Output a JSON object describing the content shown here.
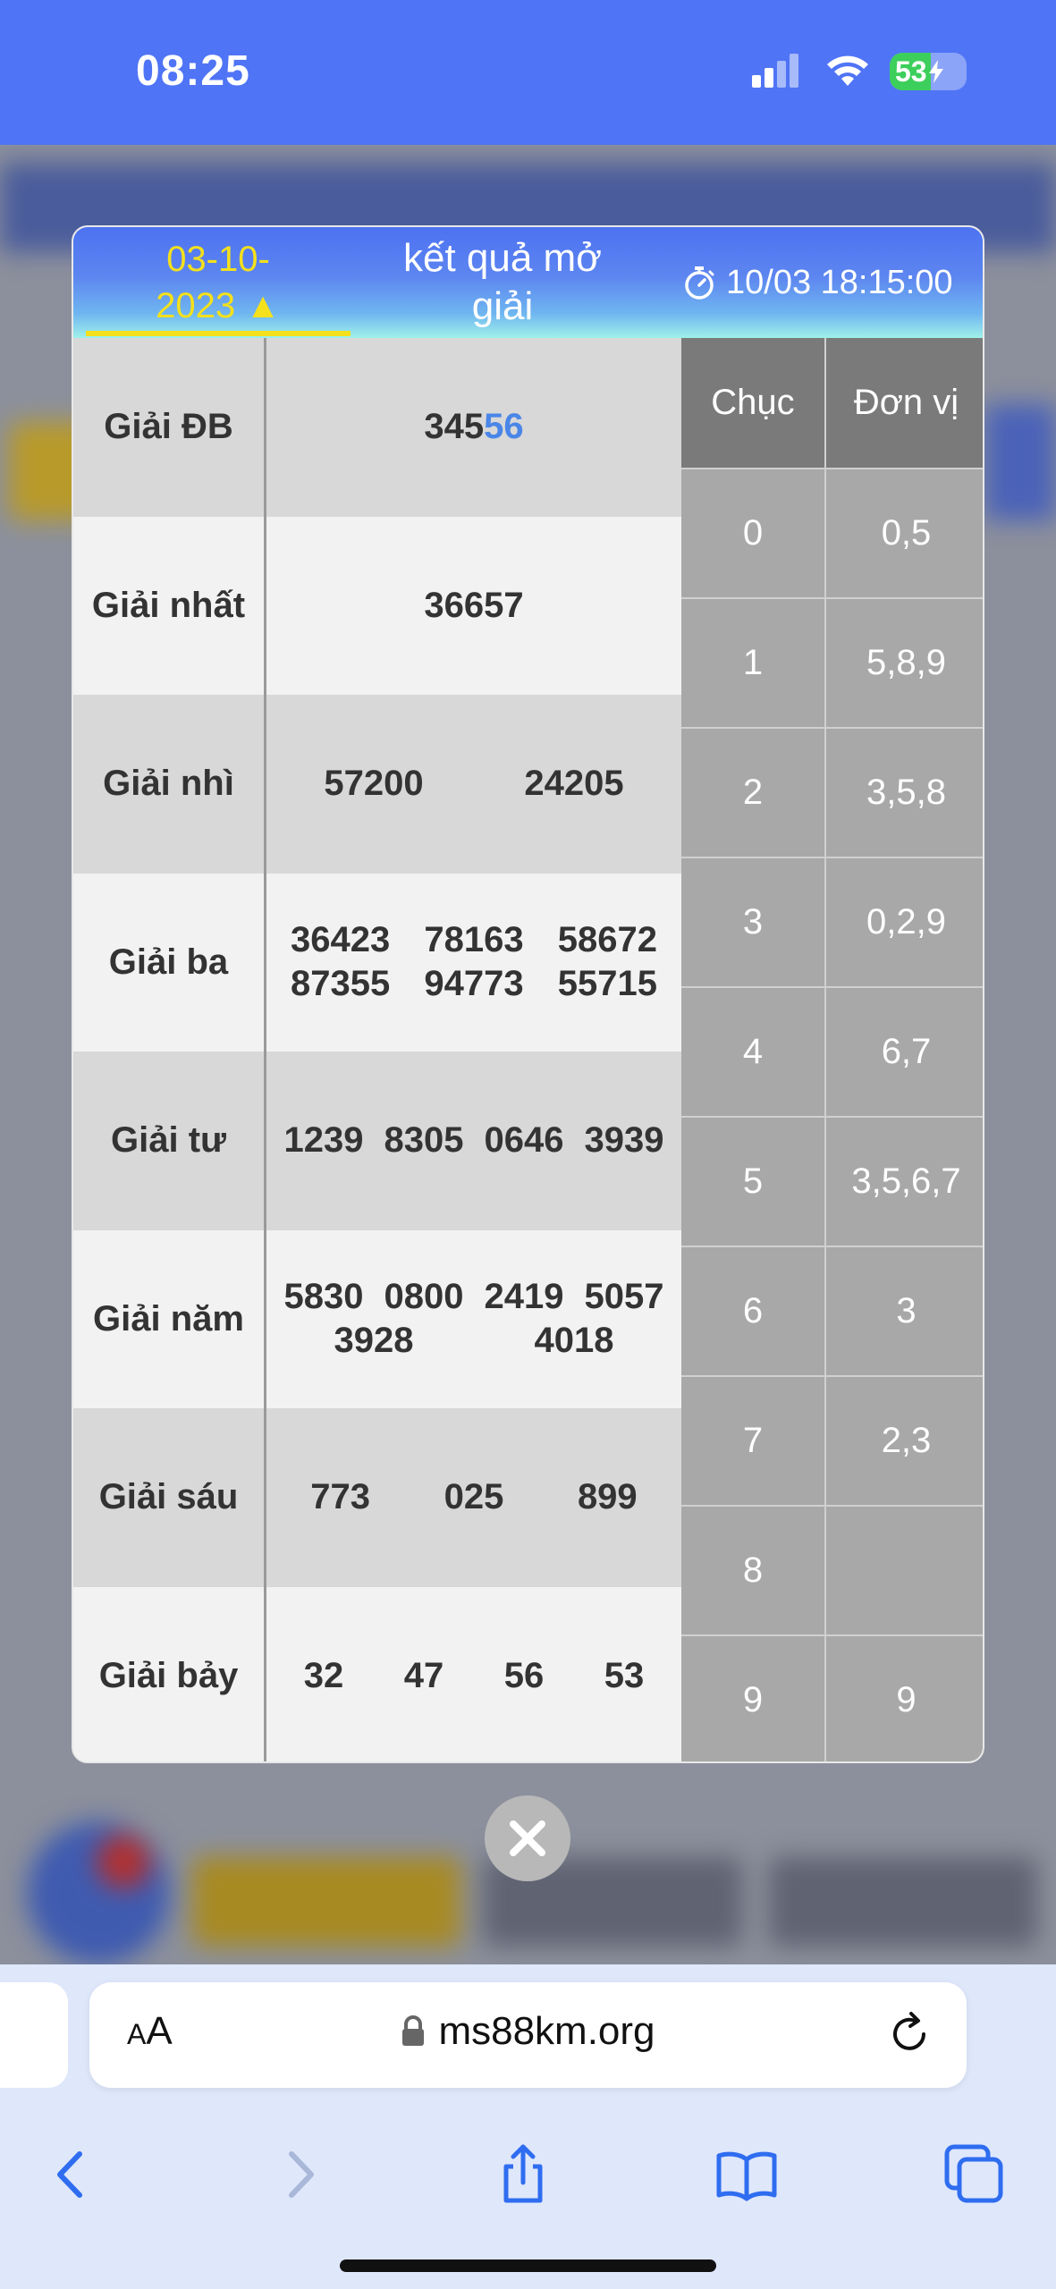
{
  "status_bar": {
    "time": "08:25",
    "battery": "53",
    "battery_level": 0.53
  },
  "modal": {
    "date_line1": "03-10-",
    "date_line2": "2023 ▲",
    "title_line1": "kết quả mở",
    "title_line2": "giải",
    "countdown": "10/03 18:15:00",
    "prizes": [
      {
        "name": "Giải ĐB",
        "numbers": [
          "345",
          "56"
        ]
      },
      {
        "name": "Giải nhất",
        "numbers": [
          "36657"
        ]
      },
      {
        "name": "Giải nhì",
        "numbers": [
          "57200",
          "24205"
        ]
      },
      {
        "name": "Giải ba",
        "numbers": [
          "36423",
          "78163",
          "58672",
          "87355",
          "94773",
          "55715"
        ]
      },
      {
        "name": "Giải tư",
        "numbers": [
          "1239",
          "8305",
          "0646",
          "3939"
        ]
      },
      {
        "name": "Giải năm",
        "numbers": [
          "5830",
          "0800",
          "2419",
          "5057",
          "3928",
          "4018"
        ]
      },
      {
        "name": "Giải sáu",
        "numbers": [
          "773",
          "025",
          "899"
        ]
      },
      {
        "name": "Giải bảy",
        "numbers": [
          "32",
          "47",
          "56",
          "53"
        ]
      }
    ],
    "dan_table": {
      "header_chuc": "Chục",
      "header_donvi": "Đơn vị",
      "rows": [
        {
          "chuc": "0",
          "donvi": "0,5"
        },
        {
          "chuc": "1",
          "donvi": "5,8,9"
        },
        {
          "chuc": "2",
          "donvi": "3,5,8"
        },
        {
          "chuc": "3",
          "donvi": "0,2,9"
        },
        {
          "chuc": "4",
          "donvi": "6,7"
        },
        {
          "chuc": "5",
          "donvi": "3,5,6,7"
        },
        {
          "chuc": "6",
          "donvi": "3"
        },
        {
          "chuc": "7",
          "donvi": "2,3"
        },
        {
          "chuc": "8",
          "donvi": ""
        },
        {
          "chuc": "9",
          "donvi": "9"
        }
      ]
    }
  },
  "safari": {
    "aa_small": "A",
    "aa_large": "A",
    "url": "ms88km.org"
  },
  "colors": {
    "accent_blue": "#4f74f5",
    "date_yellow": "#f4e01c",
    "highlight_blue": "#4a86e8"
  }
}
